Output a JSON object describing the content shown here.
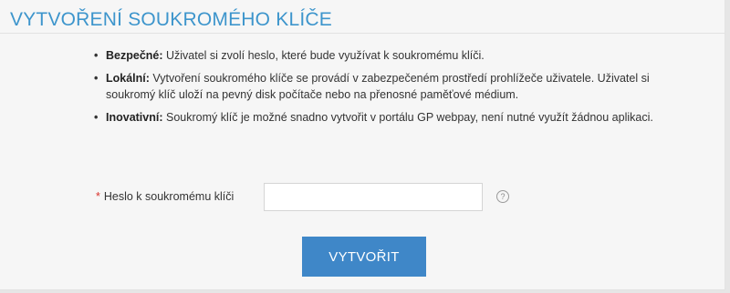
{
  "page": {
    "title": "VYTVOŘENÍ SOUKROMÉHO KLÍČE"
  },
  "features": [
    {
      "bullet": "•",
      "term": "Bezpečné:",
      "text": " Uživatel si zvolí heslo, které bude využívat k soukromému klíči."
    },
    {
      "bullet": "•",
      "term": "Lokální:",
      "text": " Vytvoření soukromého klíče se provádí v zabezpečeném prostředí prohlížeče uživatele. Uživatel si soukromý klíč uloží na pevný disk počítače nebo na přenosné paměťové médium."
    },
    {
      "bullet": "•",
      "term": "Inovativní:",
      "text": " Soukromý klíč je možné snadno vytvořit v portálu GP webpay, není nutné využít žádnou aplikaci."
    }
  ],
  "form": {
    "required_mark": "*",
    "password_label": "Heslo k soukromému klíči",
    "password_value": "",
    "password_placeholder": "",
    "help_icon": "?",
    "submit_label": "VYTVOŘIT"
  },
  "colors": {
    "title": "#3d95cc",
    "button": "#3f87c8",
    "required": "#d9322b",
    "background": "#f6f6f6"
  },
  "icons": {
    "help": "question-circle-icon"
  }
}
